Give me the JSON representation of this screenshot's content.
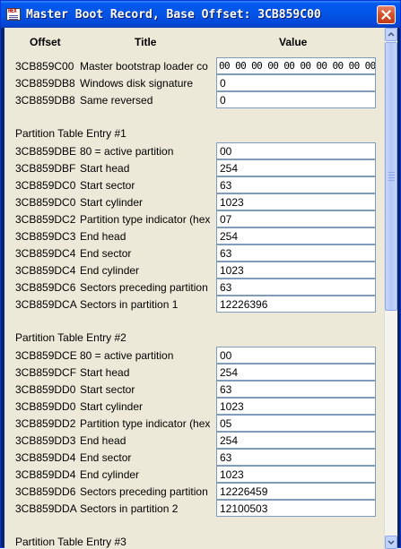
{
  "window": {
    "title": "Master Boot Record, Base Offset: 3CB859C00",
    "icon_text": "HEX"
  },
  "columns": {
    "offset": "Offset",
    "title": "Title",
    "value": "Value"
  },
  "sections": [
    {
      "heading": "",
      "rows": [
        {
          "offset": "3CB859C00",
          "title": "Master bootstrap loader co",
          "value": "00 00 00 00 00 00 00 00 00 00 00 00"
        },
        {
          "offset": "3CB859DB8",
          "title": "Windows disk signature",
          "value": "0"
        },
        {
          "offset": "3CB859DB8",
          "title": "Same reversed",
          "value": "0"
        }
      ]
    },
    {
      "heading": "Partition Table Entry #1",
      "rows": [
        {
          "offset": "3CB859DBE",
          "title": "80 = active partition",
          "value": "00"
        },
        {
          "offset": "3CB859DBF",
          "title": "Start head",
          "value": "254"
        },
        {
          "offset": "3CB859DC0",
          "title": "Start sector",
          "value": "63"
        },
        {
          "offset": "3CB859DC0",
          "title": "Start cylinder",
          "value": "1023"
        },
        {
          "offset": "3CB859DC2",
          "title": "Partition type indicator (hex",
          "value": "07"
        },
        {
          "offset": "3CB859DC3",
          "title": "End head",
          "value": "254"
        },
        {
          "offset": "3CB859DC4",
          "title": "End sector",
          "value": "63"
        },
        {
          "offset": "3CB859DC4",
          "title": "End cylinder",
          "value": "1023"
        },
        {
          "offset": "3CB859DC6",
          "title": "Sectors preceding partition",
          "value": "63"
        },
        {
          "offset": "3CB859DCA",
          "title": "Sectors in partition 1",
          "value": "12226396"
        }
      ]
    },
    {
      "heading": "Partition Table Entry #2",
      "rows": [
        {
          "offset": "3CB859DCE",
          "title": "80 = active partition",
          "value": "00"
        },
        {
          "offset": "3CB859DCF",
          "title": "Start head",
          "value": "254"
        },
        {
          "offset": "3CB859DD0",
          "title": "Start sector",
          "value": "63"
        },
        {
          "offset": "3CB859DD0",
          "title": "Start cylinder",
          "value": "1023"
        },
        {
          "offset": "3CB859DD2",
          "title": "Partition type indicator (hex",
          "value": "05"
        },
        {
          "offset": "3CB859DD3",
          "title": "End head",
          "value": "254"
        },
        {
          "offset": "3CB859DD4",
          "title": "End sector",
          "value": "63"
        },
        {
          "offset": "3CB859DD4",
          "title": "End cylinder",
          "value": "1023"
        },
        {
          "offset": "3CB859DD6",
          "title": "Sectors preceding partition",
          "value": "12226459"
        },
        {
          "offset": "3CB859DDA",
          "title": "Sectors in partition 2",
          "value": "12100503"
        }
      ]
    },
    {
      "heading": "Partition Table Entry #3",
      "rows": []
    }
  ]
}
